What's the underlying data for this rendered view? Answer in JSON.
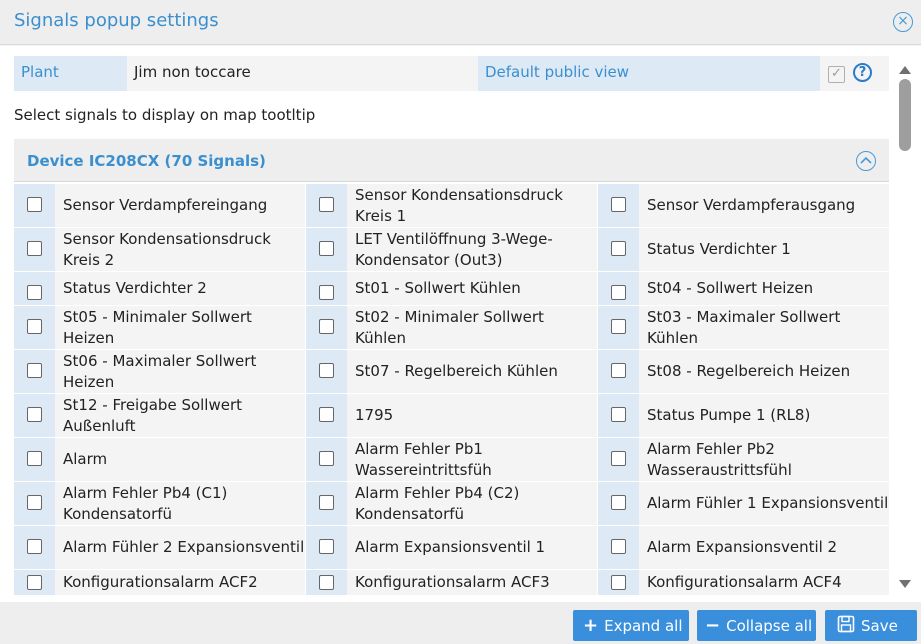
{
  "dialog": {
    "title": "Signals popup settings"
  },
  "plant_row": {
    "plant_label": "Plant",
    "plant_value": "Jim non toccare",
    "default_view_label": "Default public view",
    "default_view_checked": true
  },
  "instruction": "Select signals to display on map tootltip",
  "device": {
    "title": "Device IC208CX (70 Signals)",
    "signals": [
      [
        "Sensor Verdampfereingang",
        "Sensor Kondensationsdruck Kreis 1",
        "Sensor Verdampferausgang"
      ],
      [
        "Sensor Kondensationsdruck Kreis 2",
        "LET Ventilöffnung 3-Wege-Kondensator (Out3)",
        "Status Verdichter 1"
      ],
      [
        "Status Verdichter 2",
        "St01 - Sollwert Kühlen",
        "St04 - Sollwert Heizen"
      ],
      [
        "St05 - Minimaler Sollwert Heizen",
        "St02 - Minimaler Sollwert Kühlen",
        "St03 - Maximaler Sollwert Kühlen"
      ],
      [
        "St06 - Maximaler Sollwert Heizen",
        "St07 - Regelbereich Kühlen",
        "St08 - Regelbereich Heizen"
      ],
      [
        "St12 - Freigabe Sollwert Außenluft",
        "1795",
        "Status Pumpe 1 (RL8)"
      ],
      [
        "Alarm",
        "Alarm Fehler Pb1 Wassereintrittsfüh",
        "Alarm Fehler Pb2 Wasseraustrittsfühl"
      ],
      [
        "Alarm Fehler Pb4 (C1) Kondensatorfü",
        "Alarm Fehler Pb4 (C2) Kondensatorfü",
        "Alarm Fühler 1 Expansionsventil"
      ],
      [
        "Alarm Fühler 2 Expansionsventil",
        "Alarm Expansionsventil 1",
        "Alarm Expansionsventil 2"
      ],
      [
        "Konfigurationsalarm ACF2",
        "Konfigurationsalarm ACF3",
        "Konfigurationsalarm ACF4"
      ]
    ]
  },
  "footer": {
    "expand_label": "Expand all",
    "collapse_label": "Collapse all",
    "save_label": "Save"
  },
  "colors": {
    "accent": "#3a8fcf",
    "button": "#3a8fdc",
    "label_bg": "#ddeaf6"
  }
}
